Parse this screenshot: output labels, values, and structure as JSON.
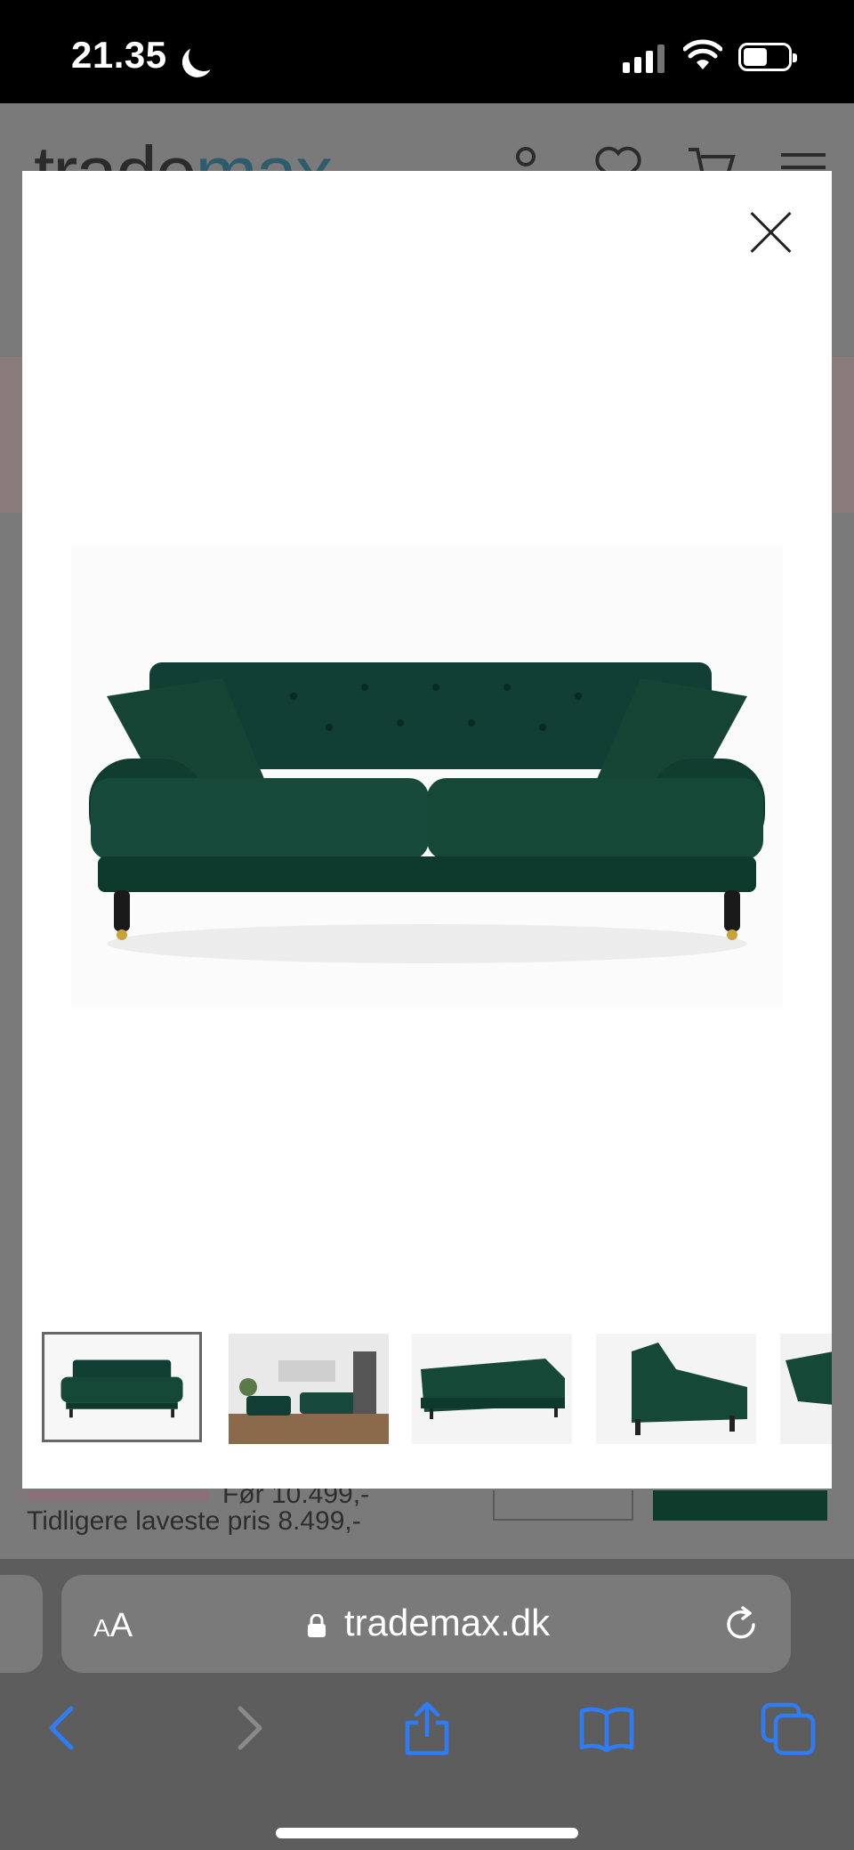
{
  "status_bar": {
    "time": "21.35",
    "icons": [
      "moon-icon",
      "cellular-signal-icon",
      "wifi-icon",
      "battery-icon"
    ]
  },
  "site": {
    "logo_primary": "trade",
    "logo_accent": "max",
    "logo_accent_color": "#2d5c6c",
    "header_icons": [
      "user-icon",
      "heart-icon",
      "cart-icon",
      "menu-icon"
    ],
    "old_price_label": "Før 10.499,-",
    "previous_lowest_price": "Tidligere laveste pris 8.499,-"
  },
  "modal": {
    "close_icon": "close-icon",
    "main_image": "green velvet three-seat sofa",
    "thumbnails": [
      {
        "label": "sofa front view",
        "active": true
      },
      {
        "label": "sofa in living room",
        "active": false
      },
      {
        "label": "sofa angled view",
        "active": false
      },
      {
        "label": "sofa side view",
        "active": false
      },
      {
        "label": "sofa detail view",
        "active": false
      }
    ],
    "sofa_color": "#0f3b30"
  },
  "browser": {
    "text_size_small": "A",
    "text_size_large": "A",
    "url": "trademax.dk",
    "toolbar": [
      "back-icon",
      "forward-icon",
      "share-icon",
      "bookmarks-icon",
      "tabs-icon"
    ],
    "accent_color": "#2f7df6"
  }
}
